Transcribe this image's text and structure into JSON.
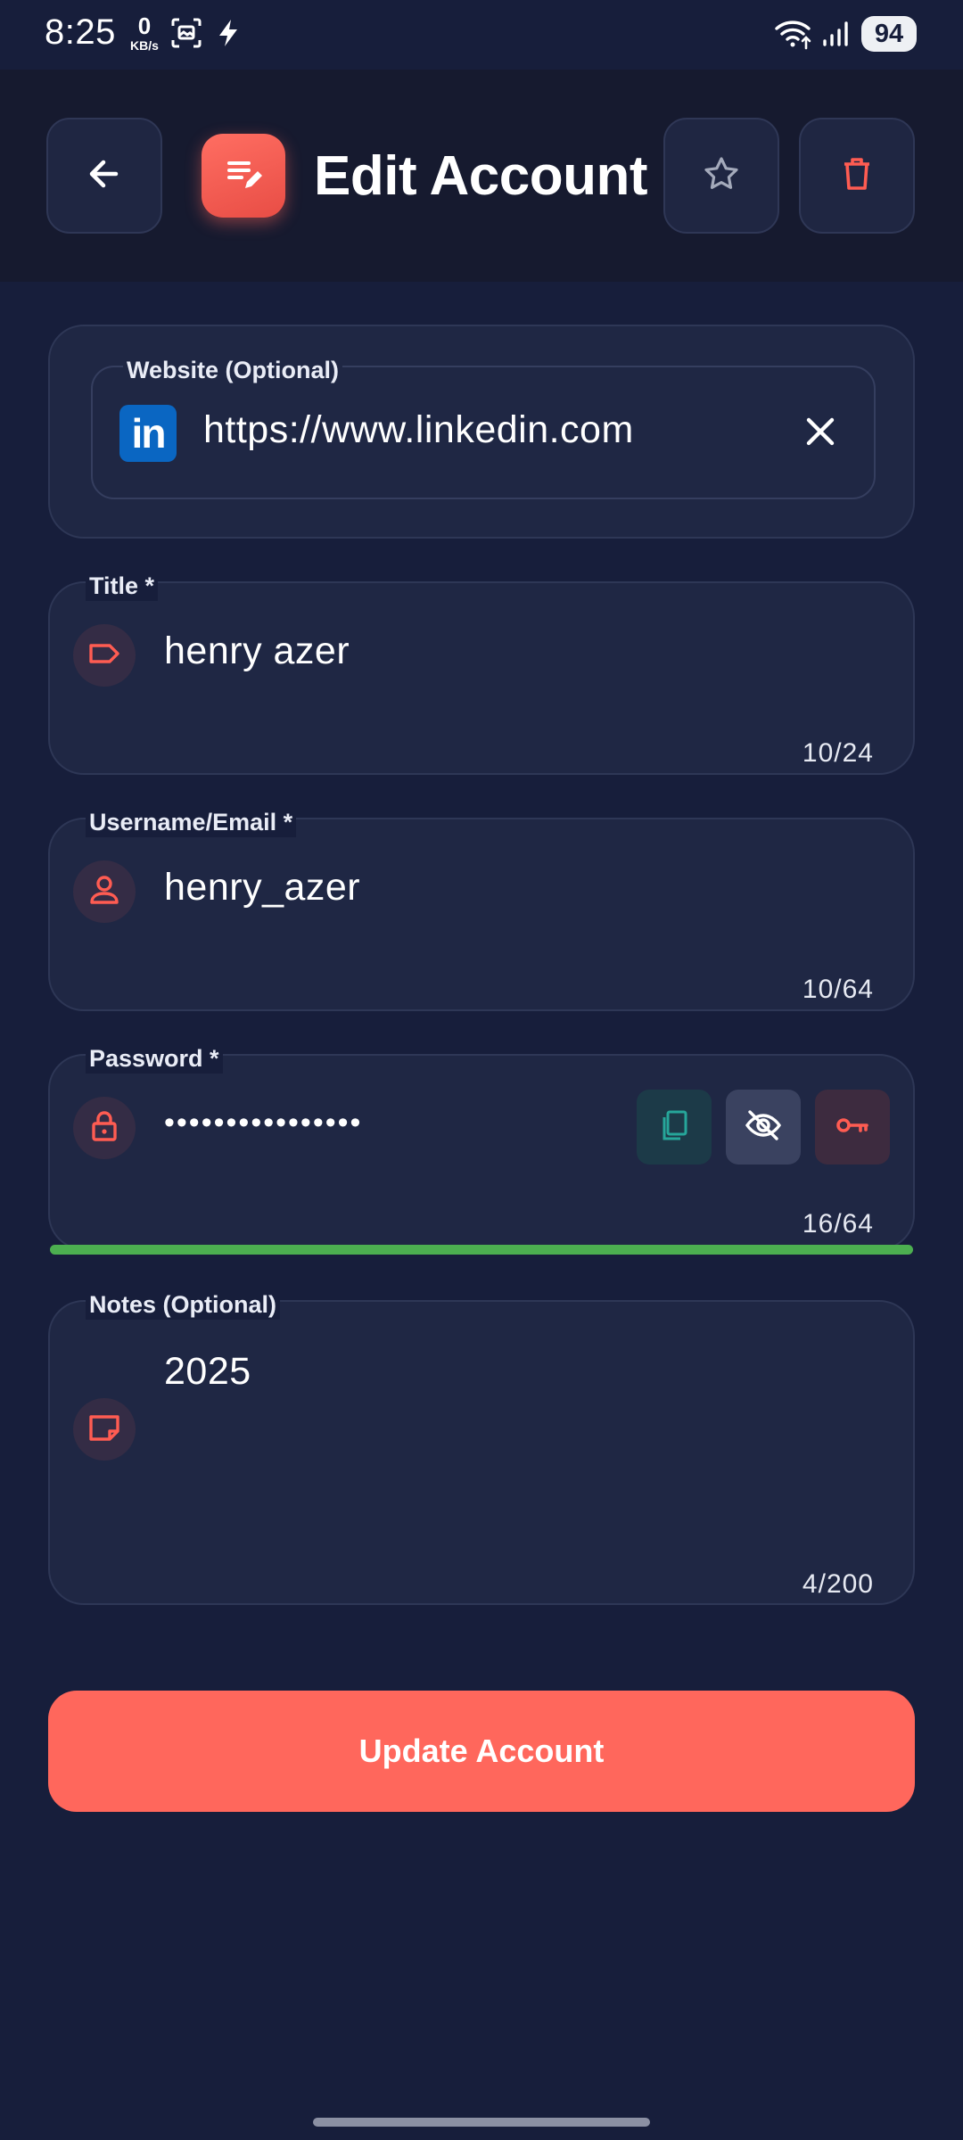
{
  "status_bar": {
    "time": "8:25",
    "net_speed_value": "0",
    "net_speed_unit": "KB/s",
    "battery": "94"
  },
  "header": {
    "title": "Edit Account",
    "back_icon": "arrow-left-icon",
    "app_icon": "edit-note-icon",
    "favorite_icon": "star-outline-icon",
    "delete_icon": "trash-icon"
  },
  "website": {
    "label": "Website (Optional)",
    "value": "https://www.linkedin.com",
    "logo_text": "in",
    "clear_icon": "close-icon"
  },
  "title_field": {
    "label": "Title *",
    "value": "henry azer",
    "counter": "10/24",
    "icon": "label-tag-icon"
  },
  "username_field": {
    "label": "Username/Email *",
    "value": "henry_azer",
    "counter": "10/64",
    "icon": "person-icon"
  },
  "password_field": {
    "label": "Password *",
    "value": "••••••••••••••••",
    "counter": "16/64",
    "icon": "lock-icon",
    "strength": 1.0,
    "strength_color": "#4caf50"
  },
  "notes_field": {
    "label": "Notes (Optional)",
    "value": "2025",
    "counter": "4/200",
    "icon": "note-icon"
  },
  "submit": {
    "label": "Update Account"
  },
  "colors": {
    "background": "#171e3b",
    "card": "#1f2744",
    "accent": "#ff675c",
    "copy_green": "#26a69a"
  }
}
